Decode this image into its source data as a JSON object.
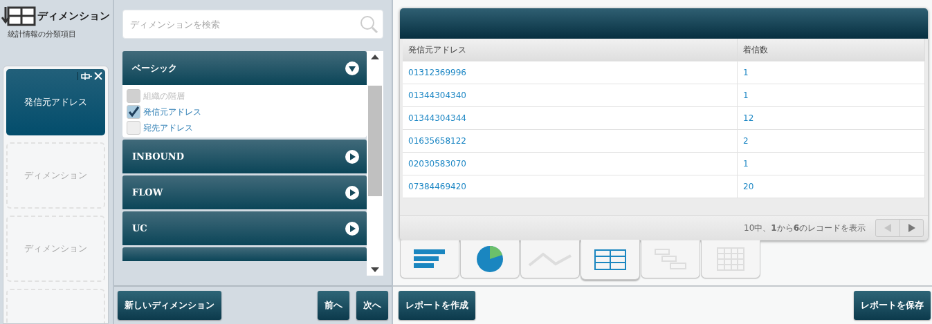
{
  "dimensions_panel": {
    "title": "ディメンション",
    "subtitle": "統計情報の分類項目",
    "slots": [
      {
        "kind": "filled",
        "label": "発信元アドレス"
      },
      {
        "kind": "empty",
        "label": "ディメンション"
      },
      {
        "kind": "empty",
        "label": "ディメンション"
      },
      {
        "kind": "cut"
      }
    ]
  },
  "picker": {
    "search": {
      "placeholder": "ディメンションを検索"
    },
    "groups": [
      {
        "label": "ベーシック",
        "expanded": true,
        "items": [
          {
            "label": "組織の階層",
            "checked": false,
            "disabled": true
          },
          {
            "label": "発信元アドレス",
            "checked": true,
            "disabled": false
          },
          {
            "label": "宛先アドレス",
            "checked": false,
            "disabled": false
          }
        ]
      },
      {
        "label": "INBOUND",
        "expanded": false
      },
      {
        "label": "FLOW",
        "expanded": false
      },
      {
        "label": "UC",
        "expanded": false
      },
      {
        "kind": "cut"
      }
    ],
    "buttons": {
      "new": "新しいディメンション",
      "prev": "前へ",
      "next": "次へ"
    }
  },
  "report": {
    "table": {
      "columns": [
        "発信元アドレス",
        "着信数"
      ],
      "rows": [
        [
          "01312369996",
          "1"
        ],
        [
          "01344304340",
          "1"
        ],
        [
          "01344304344",
          "12"
        ],
        [
          "01635658122",
          "2"
        ],
        [
          "02030583070",
          "1"
        ],
        [
          "07384469420",
          "20"
        ]
      ]
    },
    "footer": "10中、**1**から**6**のレコードを表示",
    "chart_types": [
      {
        "kind": "bar",
        "selected": false,
        "disabled": false
      },
      {
        "kind": "pie",
        "selected": false,
        "disabled": false
      },
      {
        "kind": "line",
        "selected": false,
        "disabled": true
      },
      {
        "kind": "table",
        "selected": true,
        "disabled": false
      },
      {
        "kind": "grouped",
        "selected": false,
        "disabled": true
      },
      {
        "kind": "pivot",
        "selected": false,
        "disabled": true
      }
    ],
    "buttons": {
      "create": "レポートを作成",
      "save": "レポートを保存"
    }
  }
}
